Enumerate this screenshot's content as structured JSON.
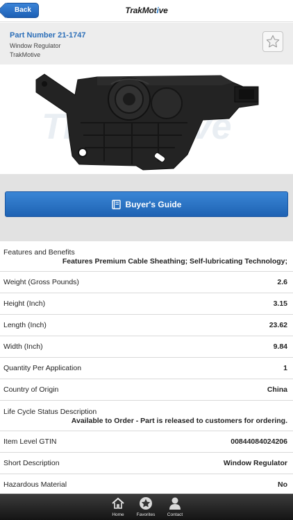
{
  "nav": {
    "back_label": "Back",
    "brand_prefix": "TrakMot",
    "brand_accent": "i",
    "brand_suffix": "ve"
  },
  "part": {
    "number_line": "Part Number 21-1747",
    "name": "Window Regulator",
    "brand": "TrakMotive",
    "favorite_icon": "star-icon"
  },
  "buyers_guide": {
    "label": "Buyer's Guide",
    "icon": "book-icon"
  },
  "specs": {
    "features": {
      "label": "Features and Benefits",
      "value": "Features Premium Cable Sheathing; Self-lubricating Technology;"
    },
    "weight": {
      "label": "Weight (Gross Pounds)",
      "value": "2.6"
    },
    "height": {
      "label": "Height (Inch)",
      "value": "3.15"
    },
    "length": {
      "label": "Length (Inch)",
      "value": "23.62"
    },
    "width": {
      "label": "Width (Inch)",
      "value": "9.84"
    },
    "qty": {
      "label": "Quantity Per Application",
      "value": "1"
    },
    "origin": {
      "label": "Country of Origin",
      "value": "China"
    },
    "lifecycle": {
      "label": "Life Cycle Status Description",
      "value": "Available to Order - Part is released to customers for ordering."
    },
    "gtin": {
      "label": "Item Level GTIN",
      "value": "00844084024206"
    },
    "short_desc": {
      "label": "Short Description",
      "value": "Window Regulator"
    },
    "hazmat": {
      "label": "Hazardous Material",
      "value": "No"
    }
  },
  "tabbar": {
    "home": "Home",
    "favorites": "Favorites",
    "contact": "Contact"
  },
  "colors": {
    "accent_blue": "#1e62b3",
    "link_blue": "#2b6eb8",
    "tabbar_dark": "#1a1a1a"
  }
}
